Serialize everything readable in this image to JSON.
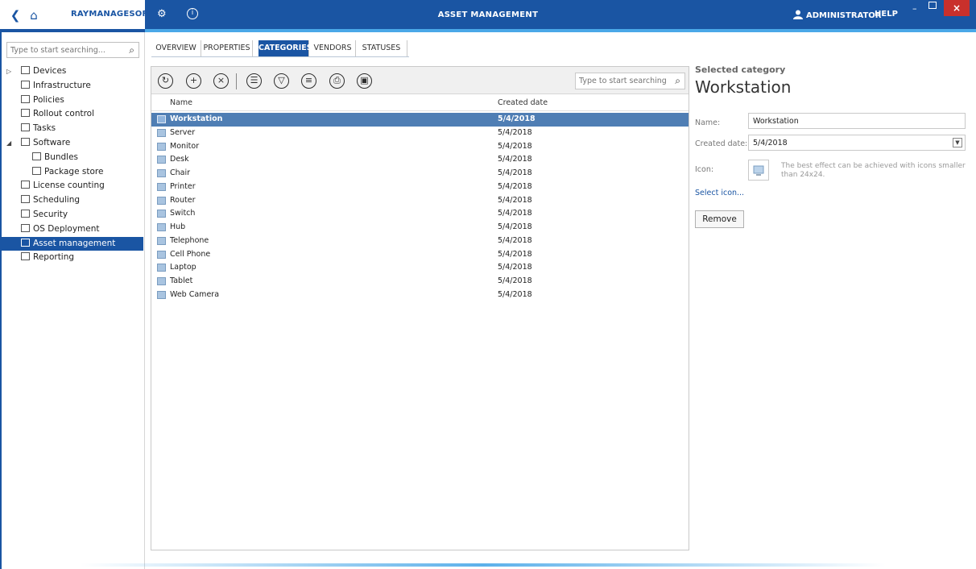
{
  "titlebar": {
    "brand": "RAYMANAGESOFT",
    "title": "ASSET MANAGEMENT",
    "user": "ADMINISTRATOR",
    "help": "HELP",
    "minimize": "–",
    "close": "×"
  },
  "sidebar": {
    "search_placeholder": "Type to start searching...",
    "items": [
      {
        "label": "Devices",
        "icon": "devices-icon",
        "indent": 0,
        "expander": "▷",
        "active": false
      },
      {
        "label": "Infrastructure",
        "icon": "infrastructure-icon",
        "indent": 0,
        "expander": "",
        "active": false
      },
      {
        "label": "Policies",
        "icon": "policies-icon",
        "indent": 0,
        "expander": "",
        "active": false
      },
      {
        "label": "Rollout control",
        "icon": "rollout-icon",
        "indent": 0,
        "expander": "",
        "active": false
      },
      {
        "label": "Tasks",
        "icon": "tasks-icon",
        "indent": 0,
        "expander": "",
        "active": false
      },
      {
        "label": "Software",
        "icon": "software-icon",
        "indent": 0,
        "expander": "◢",
        "active": false
      },
      {
        "label": "Bundles",
        "icon": "bundles-icon",
        "indent": 1,
        "expander": "",
        "active": false
      },
      {
        "label": "Package store",
        "icon": "package-store-icon",
        "indent": 1,
        "expander": "",
        "active": false
      },
      {
        "label": "License counting",
        "icon": "license-icon",
        "indent": 0,
        "expander": "",
        "active": false
      },
      {
        "label": "Scheduling",
        "icon": "clock-icon",
        "indent": 0,
        "expander": "",
        "active": false
      },
      {
        "label": "Security",
        "icon": "shield-icon",
        "indent": 0,
        "expander": "",
        "active": false
      },
      {
        "label": "OS Deployment",
        "icon": "windows-icon",
        "indent": 0,
        "expander": "",
        "active": false
      },
      {
        "label": "Asset management",
        "icon": "asset-list-icon",
        "indent": 0,
        "expander": "",
        "active": true
      },
      {
        "label": "Reporting",
        "icon": "bar-chart-icon",
        "indent": 0,
        "expander": "",
        "active": false
      }
    ]
  },
  "tabs": [
    {
      "label": "OVERVIEW",
      "active": false
    },
    {
      "label": "PROPERTIES",
      "active": false
    },
    {
      "label": "CATEGORIES",
      "active": true
    },
    {
      "label": "VENDORS",
      "active": false
    },
    {
      "label": "STATUSES",
      "active": false
    }
  ],
  "grid": {
    "search_placeholder": "Type to start searching...",
    "columns": [
      "Name",
      "Created date"
    ],
    "rows": [
      {
        "name": "Workstation",
        "date": "5/4/2018",
        "icon": "workstation-icon",
        "selected": true
      },
      {
        "name": "Server",
        "date": "5/4/2018",
        "icon": "server-icon",
        "selected": false
      },
      {
        "name": "Monitor",
        "date": "5/4/2018",
        "icon": "monitor-icon",
        "selected": false
      },
      {
        "name": "Desk",
        "date": "5/4/2018",
        "icon": "desk-icon",
        "selected": false
      },
      {
        "name": "Chair",
        "date": "5/4/2018",
        "icon": "chair-icon",
        "selected": false
      },
      {
        "name": "Printer",
        "date": "5/4/2018",
        "icon": "printer-icon",
        "selected": false
      },
      {
        "name": "Router",
        "date": "5/4/2018",
        "icon": "router-icon",
        "selected": false
      },
      {
        "name": "Switch",
        "date": "5/4/2018",
        "icon": "switch-icon",
        "selected": false
      },
      {
        "name": "Hub",
        "date": "5/4/2018",
        "icon": "hub-icon",
        "selected": false
      },
      {
        "name": "Telephone",
        "date": "5/4/2018",
        "icon": "telephone-icon",
        "selected": false
      },
      {
        "name": "Cell Phone",
        "date": "5/4/2018",
        "icon": "cell-phone-icon",
        "selected": false
      },
      {
        "name": "Laptop",
        "date": "5/4/2018",
        "icon": "laptop-icon",
        "selected": false
      },
      {
        "name": "Tablet",
        "date": "5/4/2018",
        "icon": "tablet-icon",
        "selected": false
      },
      {
        "name": "Web Camera",
        "date": "5/4/2018",
        "icon": "web-camera-icon",
        "selected": false
      }
    ]
  },
  "detail": {
    "caption": "Selected category",
    "title": "Workstation",
    "name_label": "Name:",
    "name_value": "Workstation",
    "date_label": "Created date:",
    "date_value": "5/4/2018",
    "icon_label": "Icon:",
    "icon_hint": "The best effect can be achieved with icons smaller than 24x24.",
    "select_icon": "Select icon...",
    "remove": "Remove"
  },
  "colors": {
    "brand": "#1a55a3",
    "accent": "#4aa8e8",
    "selection": "#4f7eb4",
    "close": "#c9302c"
  }
}
